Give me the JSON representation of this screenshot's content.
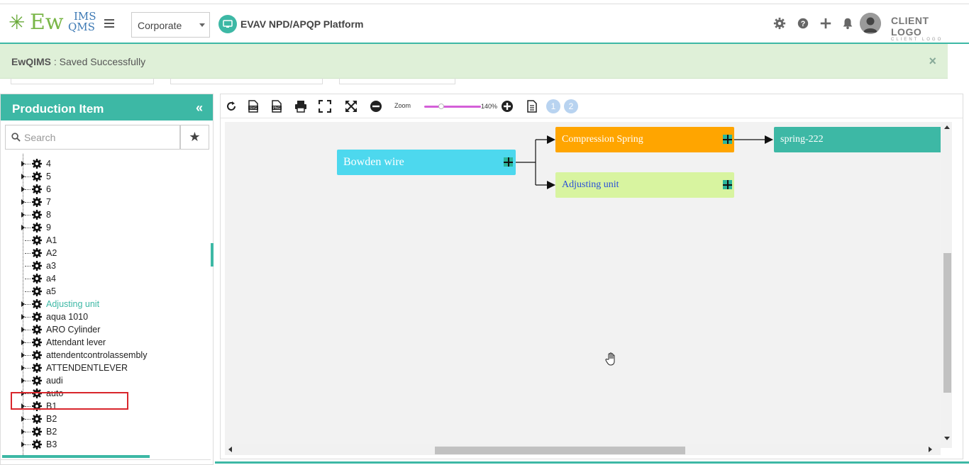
{
  "header": {
    "logo_ew": "Ew",
    "logo_ims": "IMS",
    "logo_qms": "QMS",
    "company_select": "Corporate",
    "platform_title": "EVAV NPD/APQP Platform",
    "client_logo_line1": "CLIENT LOGO",
    "client_logo_line2": "CLIENT LOGO",
    "icons": [
      "gear-icon",
      "help-icon",
      "plus-icon",
      "bell-icon",
      "avatar"
    ]
  },
  "alert": {
    "app": "EwQIMS",
    "message": " : Saved Successfully",
    "close": "×"
  },
  "sidebar": {
    "title": "Production Item",
    "collapse": "«",
    "search_placeholder": "Search",
    "tree": [
      {
        "label": "4",
        "expandable": true
      },
      {
        "label": "5",
        "expandable": true
      },
      {
        "label": "6",
        "expandable": true
      },
      {
        "label": "7",
        "expandable": true
      },
      {
        "label": "8",
        "expandable": true
      },
      {
        "label": "9",
        "expandable": true
      },
      {
        "label": "A1",
        "expandable": false
      },
      {
        "label": "A2",
        "expandable": false
      },
      {
        "label": "a3",
        "expandable": false
      },
      {
        "label": "a4",
        "expandable": false
      },
      {
        "label": "a5",
        "expandable": false
      },
      {
        "label": "Adjusting unit",
        "expandable": true,
        "selected": true
      },
      {
        "label": "aqua 1010",
        "expandable": true
      },
      {
        "label": "ARO Cylinder",
        "expandable": true
      },
      {
        "label": "Attendant lever",
        "expandable": true
      },
      {
        "label": "attendentcontrolassembly",
        "expandable": true
      },
      {
        "label": "ATTENDENTLEVER",
        "expandable": true
      },
      {
        "label": "audi",
        "expandable": true
      },
      {
        "label": "auto",
        "expandable": true
      },
      {
        "label": "B1",
        "expandable": true
      },
      {
        "label": "B2",
        "expandable": true
      },
      {
        "label": "B2",
        "expandable": true
      },
      {
        "label": "B3",
        "expandable": true
      }
    ]
  },
  "toolbar": {
    "zoom_label": "Zoom",
    "zoom_percent": "140%",
    "zoom_level": 0.3,
    "pages": [
      "1",
      "2"
    ]
  },
  "diagram": {
    "root": {
      "label": "Bowden wire",
      "color": "#4dd8ee"
    },
    "children": [
      {
        "label": "Compression Spring",
        "color": "#ffa500",
        "text_color": "#ffffff"
      },
      {
        "label": "Adjusting unit",
        "color": "#d8f4a0",
        "text_color": "#2a50d8"
      }
    ],
    "grandchild": {
      "label": "spring-222",
      "color": "#3db8a5",
      "text_color": "#ffffff"
    }
  },
  "colors": {
    "accent": "#3db8a5",
    "alert_bg": "#dff0d8",
    "selection_border": "#d9262c"
  }
}
